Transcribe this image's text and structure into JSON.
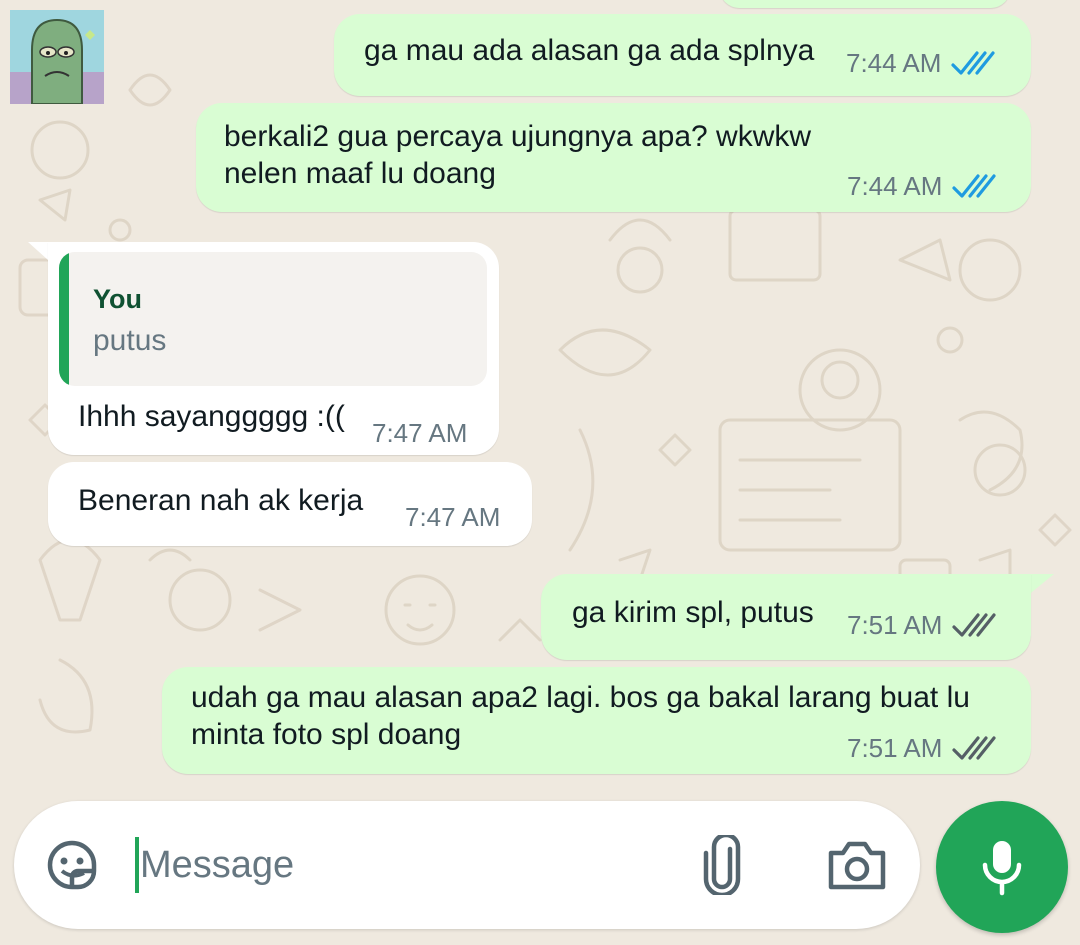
{
  "colors": {
    "outgoing_bubble": "#d9fdd3",
    "incoming_bubble": "#ffffff",
    "wallpaper": "#efe9df",
    "accent_green": "#21a558",
    "read_tick_blue": "#53bdeb",
    "delivered_tick_grey": "#667781"
  },
  "chat": {
    "contact_avatar_icon": "sticker-avatar",
    "messages": [
      {
        "direction": "outgoing",
        "text": "ga mau ada alasan ga ada splnya",
        "time": "7:44 AM",
        "status": "read"
      },
      {
        "direction": "outgoing",
        "text": "berkali2 gua percaya ujungnya apa? wkwkw\nnelen maaf lu doang",
        "time": "7:44 AM",
        "status": "read"
      },
      {
        "direction": "incoming",
        "reply_to": {
          "author": "You",
          "text": "putus"
        },
        "text": "Ihhh sayanggggg :((",
        "time": "7:47 AM"
      },
      {
        "direction": "incoming",
        "text": "Beneran nah ak kerja",
        "time": "7:47 AM"
      },
      {
        "direction": "outgoing",
        "text": "ga kirim spl, putus",
        "time": "7:51 AM",
        "status": "delivered"
      },
      {
        "direction": "outgoing",
        "text": "udah ga mau alasan apa2 lagi. bos ga bakal larang buat lu\nminta foto spl doang",
        "time": "7:51 AM",
        "status": "delivered"
      }
    ]
  },
  "composer": {
    "placeholder": "Message",
    "value": "",
    "emoji_icon": "sticker-icon",
    "attach_icon": "paperclip-icon",
    "camera_icon": "camera-icon",
    "send_icon": "microphone-icon"
  }
}
